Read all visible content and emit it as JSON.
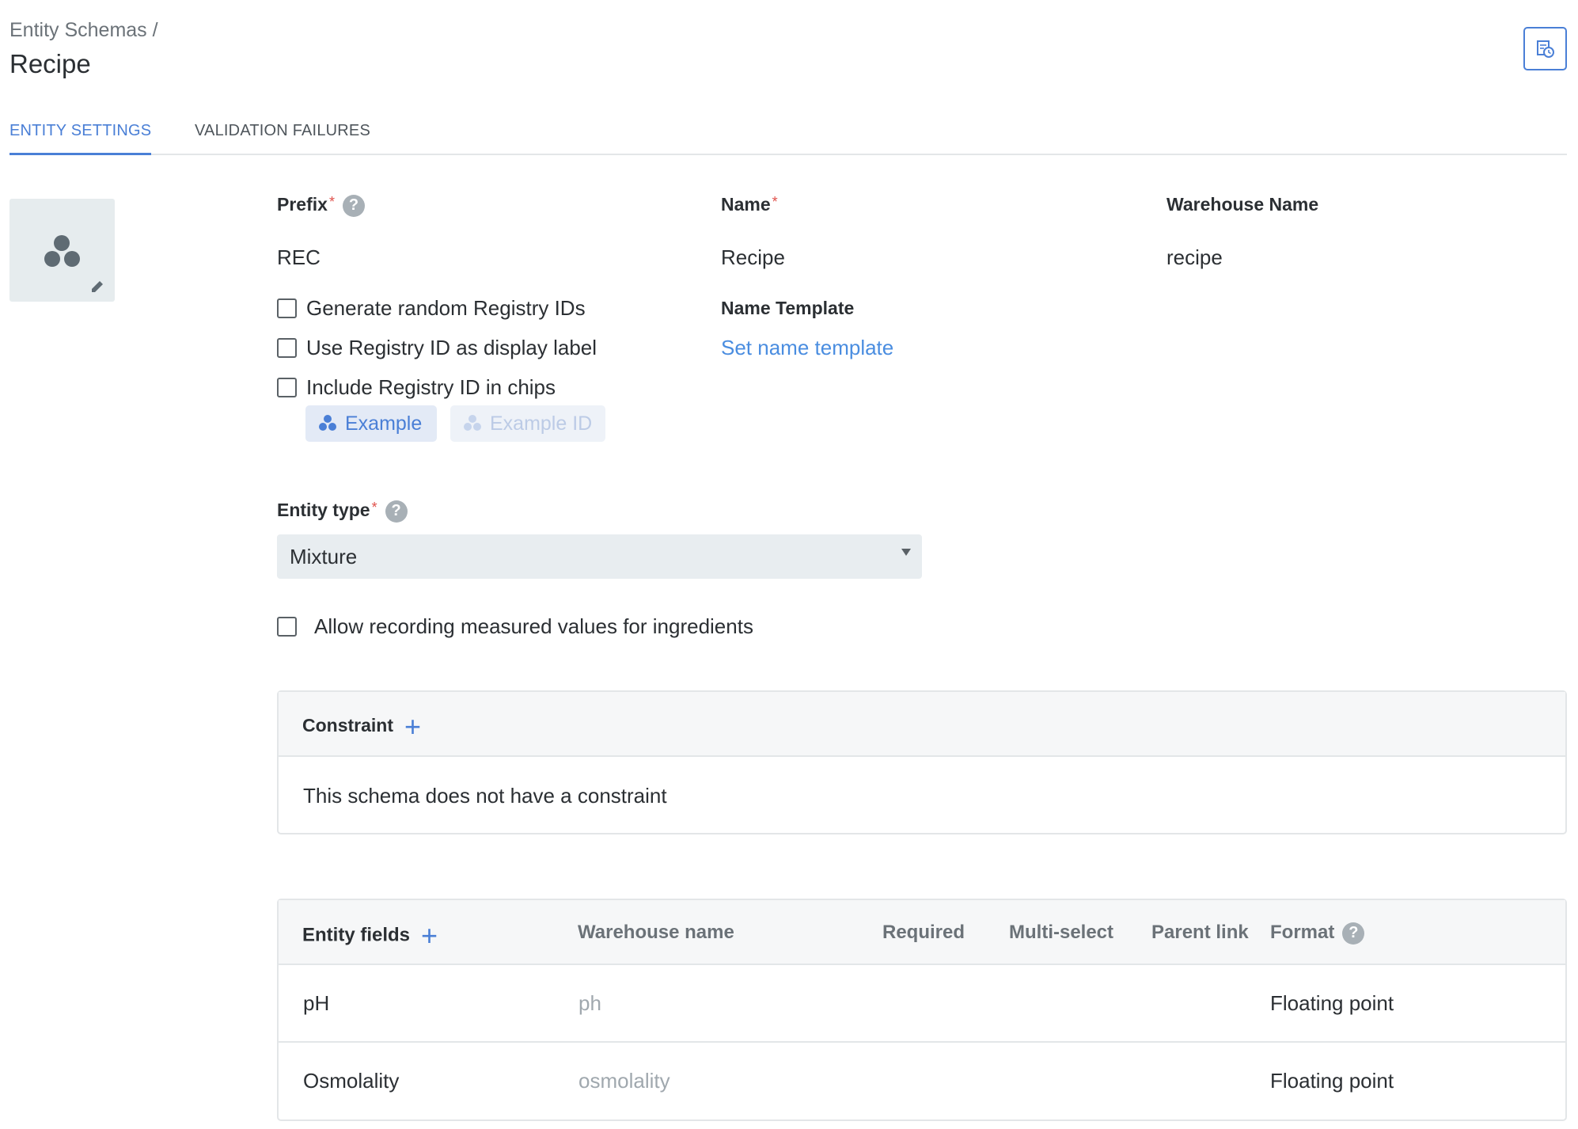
{
  "header": {
    "breadcrumb": "Entity Schemas /",
    "title": "Recipe"
  },
  "tabs": [
    {
      "label": "ENTITY SETTINGS",
      "active": true
    },
    {
      "label": "VALIDATION FAILURES",
      "active": false
    }
  ],
  "form": {
    "prefix": {
      "label": "Prefix",
      "value": "REC",
      "required_mark": "*",
      "help": "?"
    },
    "name": {
      "label": "Name",
      "value": "Recipe",
      "required_mark": "*"
    },
    "warehouse_name": {
      "label": "Warehouse Name",
      "value": "recipe"
    },
    "name_template": {
      "label": "Name Template",
      "link": "Set name template"
    },
    "checkboxes": [
      {
        "label": "Generate random Registry IDs",
        "checked": false
      },
      {
        "label": "Use Registry ID as display label",
        "checked": false
      },
      {
        "label": "Include Registry ID in chips",
        "checked": false
      }
    ],
    "chips": {
      "example": "Example",
      "example_id": "Example ID"
    },
    "entity_type": {
      "label": "Entity type",
      "required_mark": "*",
      "help": "?",
      "value": "Mixture"
    },
    "allow_measured": {
      "label": "Allow recording measured values for ingredients",
      "checked": false
    }
  },
  "constraint": {
    "title": "Constraint",
    "add": "+",
    "empty_text": "This schema does not have a constraint"
  },
  "fields_table": {
    "columns": [
      "Entity fields",
      "Warehouse name",
      "Required",
      "Multi-select",
      "Parent link",
      "Format"
    ],
    "add": "+",
    "format_help": "?",
    "rows": [
      {
        "name": "pH",
        "warehouse": "ph",
        "format": "Floating point"
      },
      {
        "name": "Osmolality",
        "warehouse": "osmolality",
        "format": "Floating point"
      }
    ]
  },
  "colors": {
    "accent": "#4a7fd6",
    "required": "#e0514b",
    "muted": "#a0a8ae"
  }
}
